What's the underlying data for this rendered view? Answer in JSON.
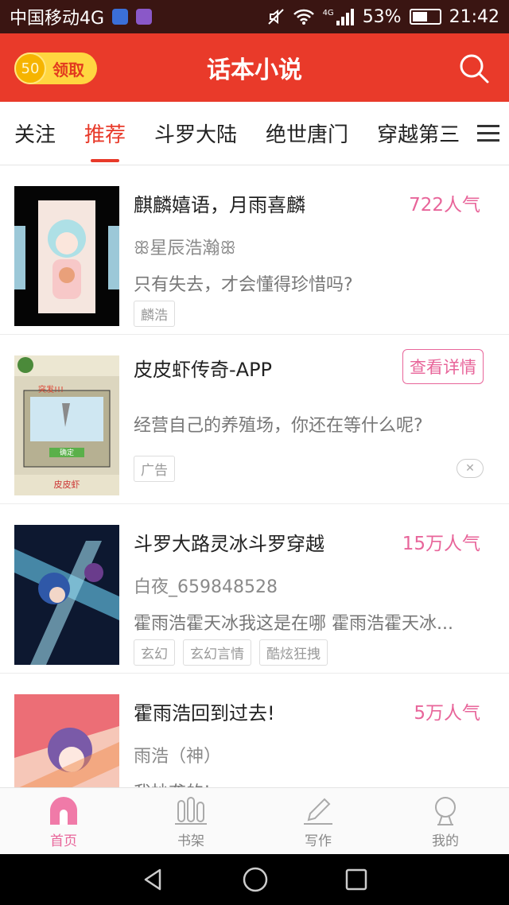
{
  "status_bar": {
    "carrier": "中国移动4G",
    "network": "4G",
    "battery": "53%",
    "time": "21:42"
  },
  "header": {
    "title": "话本小说",
    "coins": "50",
    "claim_label": "领取"
  },
  "tabs": [
    "关注",
    "推荐",
    "斗罗大陆",
    "绝世唐门",
    "穿越第三"
  ],
  "active_tab": 1,
  "items": [
    {
      "title": "麒麟嬉语，月雨喜麟",
      "popularity": "722人气",
      "author": "ꕥ星辰浩瀚ꕥ",
      "desc": "只有失去，才会懂得珍惜吗?",
      "tags": [
        "麟浩"
      ]
    },
    {
      "title": "皮皮虾传奇-APP",
      "button": "查看详情",
      "desc": "经营自己的养殖场，你还在等什么呢?",
      "tags": [
        "广告"
      ],
      "close": "✕",
      "art_text": [
        "突发!!!",
        "确定",
        "皮皮虾"
      ]
    },
    {
      "title": "斗罗大路灵冰斗罗穿越",
      "popularity": "15万人气",
      "author": "白夜_659848528",
      "desc": "霍雨浩霍天冰我这是在哪 霍雨浩霍天冰...",
      "tags": [
        "玄幻",
        "玄幻言情",
        "酷炫狂拽"
      ]
    },
    {
      "title": "霍雨浩回到过去!",
      "popularity": "5万人气",
      "author": "雨浩（神）",
      "desc": "我抄袭的!"
    }
  ],
  "bottom_nav": [
    "首页",
    "书架",
    "写作",
    "我的"
  ],
  "colors": {
    "brand_red": "#e93a2a",
    "pink": "#e8659a",
    "status_bar": "#3a1512"
  }
}
